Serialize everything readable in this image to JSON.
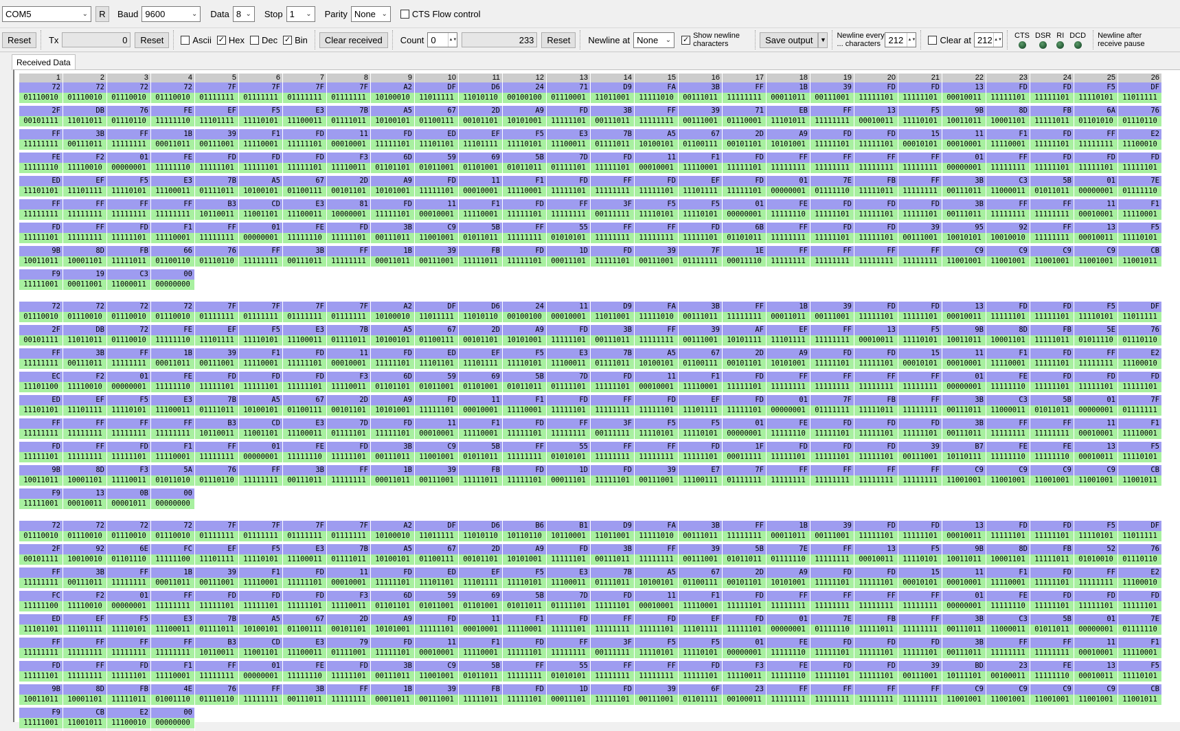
{
  "toolbar1": {
    "port": "COM5",
    "rescan": "R",
    "baud_label": "Baud",
    "baud": "9600",
    "data_label": "Data",
    "data_bits": "8",
    "stop_label": "Stop",
    "stop_bits": "1",
    "parity_label": "Parity",
    "parity": "None",
    "cts_label": "CTS Flow control"
  },
  "toolbar2": {
    "reset": "Reset",
    "tx_label": "Tx",
    "tx_count": "0",
    "tx_reset": "Reset",
    "ascii": "Ascii",
    "hex": "Hex",
    "dec": "Dec",
    "bin": "Bin",
    "clear_received": "Clear received",
    "count_label": "Count",
    "count": "0",
    "received_count": "233",
    "count_reset": "Reset",
    "newline_at_label": "Newline at",
    "newline_at": "None",
    "show_newline": "Show newline characters",
    "save_output": "Save output",
    "newline_every": "Newline every ... characters",
    "newline_every_value": "212",
    "clear_at": "Clear at",
    "clear_at_value": "212",
    "cts": "CTS",
    "dsr": "DSR",
    "ri": "RI",
    "dcd": "DCD",
    "newline_after": "Newline after receive pause"
  },
  "checks": {
    "cts": false,
    "ascii": false,
    "hex": true,
    "dec": false,
    "bin": true,
    "show_newline": true,
    "clear_at": false
  },
  "tab_label": "Received Data",
  "columns": [
    "1",
    "2",
    "3",
    "4",
    "5",
    "6",
    "7",
    "8",
    "9",
    "10",
    "11",
    "12",
    "13",
    "14",
    "15",
    "16",
    "17",
    "18",
    "19",
    "20",
    "21",
    "22",
    "23",
    "24",
    "25",
    "26"
  ],
  "blocks": [
    [
      [
        "72",
        "72",
        "72",
        "72",
        "7F",
        "7F",
        "7F",
        "7F",
        "A2",
        "DF",
        "D6",
        "24",
        "71",
        "D9",
        "FA",
        "3B",
        "FF",
        "1B",
        "39",
        "FD",
        "FD",
        "13",
        "FD",
        "FD",
        "F5",
        "DF"
      ],
      [
        "2F",
        "DB",
        "76",
        "FE",
        "EF",
        "F5",
        "E3",
        "7B",
        "A5",
        "67",
        "2D",
        "A9",
        "FD",
        "3B",
        "FF",
        "39",
        "71",
        "EB",
        "FF",
        "13",
        "F5",
        "9B",
        "8D",
        "FB",
        "6A",
        "76"
      ],
      [
        "FF",
        "3B",
        "FF",
        "1B",
        "39",
        "F1",
        "FD",
        "11",
        "FD",
        "ED",
        "EF",
        "F5",
        "E3",
        "7B",
        "A5",
        "67",
        "2D",
        "A9",
        "FD",
        "FD",
        "15",
        "11",
        "F1",
        "FD",
        "FF",
        "E2"
      ],
      [
        "FE",
        "F2",
        "01",
        "FE",
        "FD",
        "FD",
        "FD",
        "F3",
        "6D",
        "59",
        "69",
        "5B",
        "7D",
        "FD",
        "11",
        "F1",
        "FD",
        "FF",
        "FF",
        "FF",
        "FF",
        "01",
        "FF",
        "FD",
        "FD",
        "FD"
      ],
      [
        "ED",
        "EF",
        "F5",
        "E3",
        "7B",
        "A5",
        "67",
        "2D",
        "A9",
        "FD",
        "11",
        "F1",
        "FD",
        "FF",
        "FD",
        "EF",
        "FD",
        "01",
        "7E",
        "FB",
        "FF",
        "3B",
        "C3",
        "5B",
        "01",
        "7E"
      ],
      [
        "FF",
        "FF",
        "FF",
        "FF",
        "B3",
        "CD",
        "E3",
        "81",
        "FD",
        "11",
        "F1",
        "FD",
        "FF",
        "3F",
        "F5",
        "F5",
        "01",
        "FE",
        "FD",
        "FD",
        "FD",
        "3B",
        "FF",
        "FF",
        "11",
        "F1"
      ],
      [
        "FD",
        "FF",
        "FD",
        "F1",
        "FF",
        "01",
        "FE",
        "FD",
        "3B",
        "C9",
        "5B",
        "FF",
        "55",
        "FF",
        "FF",
        "FD",
        "6B",
        "FF",
        "FD",
        "FD",
        "39",
        "95",
        "92",
        "FF",
        "13",
        "F5"
      ],
      [
        "9B",
        "8D",
        "FB",
        "66",
        "76",
        "FF",
        "3B",
        "FF",
        "1B",
        "39",
        "FB",
        "FD",
        "1D",
        "FD",
        "39",
        "7F",
        "1E",
        "FF",
        "FF",
        "FF",
        "FF",
        "C9",
        "C9",
        "C9",
        "C9",
        "CB"
      ],
      [
        "F9",
        "19",
        "C3",
        "00"
      ]
    ],
    [
      [
        "72",
        "72",
        "72",
        "72",
        "7F",
        "7F",
        "7F",
        "7F",
        "A2",
        "DF",
        "D6",
        "24",
        "11",
        "D9",
        "FA",
        "3B",
        "FF",
        "1B",
        "39",
        "FD",
        "FD",
        "13",
        "FD",
        "FD",
        "F5",
        "DF"
      ],
      [
        "2F",
        "DB",
        "72",
        "FE",
        "EF",
        "F5",
        "E3",
        "7B",
        "A5",
        "67",
        "2D",
        "A9",
        "FD",
        "3B",
        "FF",
        "39",
        "AF",
        "EF",
        "FF",
        "13",
        "F5",
        "9B",
        "8D",
        "FB",
        "5E",
        "76"
      ],
      [
        "FF",
        "3B",
        "FF",
        "1B",
        "39",
        "F1",
        "FD",
        "11",
        "FD",
        "ED",
        "EF",
        "F5",
        "E3",
        "7B",
        "A5",
        "67",
        "2D",
        "A9",
        "FD",
        "FD",
        "15",
        "11",
        "F1",
        "FD",
        "FF",
        "E2"
      ],
      [
        "EC",
        "F2",
        "01",
        "FE",
        "FD",
        "FD",
        "FD",
        "F3",
        "6D",
        "59",
        "69",
        "5B",
        "7D",
        "FD",
        "11",
        "F1",
        "FD",
        "FF",
        "FF",
        "FF",
        "FF",
        "01",
        "FE",
        "FD",
        "FD",
        "FD"
      ],
      [
        "ED",
        "EF",
        "F5",
        "E3",
        "7B",
        "A5",
        "67",
        "2D",
        "A9",
        "FD",
        "11",
        "F1",
        "FD",
        "FF",
        "FD",
        "EF",
        "FD",
        "01",
        "7F",
        "FB",
        "FF",
        "3B",
        "C3",
        "5B",
        "01",
        "7F"
      ],
      [
        "FF",
        "FF",
        "FF",
        "FF",
        "B3",
        "CD",
        "E3",
        "7D",
        "FD",
        "11",
        "F1",
        "FD",
        "FF",
        "3F",
        "F5",
        "F5",
        "01",
        "FE",
        "FD",
        "FD",
        "FD",
        "3B",
        "FF",
        "FF",
        "11",
        "F1"
      ],
      [
        "FD",
        "FF",
        "FD",
        "F1",
        "FF",
        "01",
        "FE",
        "FD",
        "3B",
        "C9",
        "5B",
        "FF",
        "55",
        "FF",
        "FF",
        "FD",
        "1F",
        "FD",
        "FD",
        "FD",
        "39",
        "B7",
        "FE",
        "FE",
        "13",
        "F5"
      ],
      [
        "9B",
        "8D",
        "F3",
        "5A",
        "76",
        "FF",
        "3B",
        "FF",
        "1B",
        "39",
        "FB",
        "FD",
        "1D",
        "FD",
        "39",
        "E7",
        "7F",
        "FF",
        "FF",
        "FF",
        "FF",
        "C9",
        "C9",
        "C9",
        "C9",
        "CB"
      ],
      [
        "F9",
        "13",
        "0B",
        "00"
      ]
    ],
    [
      [
        "72",
        "72",
        "72",
        "72",
        "7F",
        "7F",
        "7F",
        "7F",
        "A2",
        "DF",
        "D6",
        "B6",
        "B1",
        "D9",
        "FA",
        "3B",
        "FF",
        "1B",
        "39",
        "FD",
        "FD",
        "13",
        "FD",
        "FD",
        "F5",
        "DF"
      ],
      [
        "2F",
        "92",
        "6E",
        "FC",
        "EF",
        "F5",
        "E3",
        "7B",
        "A5",
        "67",
        "2D",
        "A9",
        "FD",
        "3B",
        "FF",
        "39",
        "5B",
        "7E",
        "FF",
        "13",
        "F5",
        "9B",
        "8D",
        "FB",
        "52",
        "76"
      ],
      [
        "FF",
        "3B",
        "FF",
        "1B",
        "39",
        "F1",
        "FD",
        "11",
        "FD",
        "ED",
        "EF",
        "F5",
        "E3",
        "7B",
        "A5",
        "67",
        "2D",
        "A9",
        "FD",
        "FD",
        "15",
        "11",
        "F1",
        "FD",
        "FF",
        "E2"
      ],
      [
        "FC",
        "F2",
        "01",
        "FF",
        "FD",
        "FD",
        "FD",
        "F3",
        "6D",
        "59",
        "69",
        "5B",
        "7D",
        "FD",
        "11",
        "F1",
        "FD",
        "FF",
        "FF",
        "FF",
        "FF",
        "01",
        "FE",
        "FD",
        "FD",
        "FD"
      ],
      [
        "ED",
        "EF",
        "F5",
        "E3",
        "7B",
        "A5",
        "67",
        "2D",
        "A9",
        "FD",
        "11",
        "F1",
        "FD",
        "FF",
        "FD",
        "EF",
        "FD",
        "01",
        "7E",
        "FB",
        "FF",
        "3B",
        "C3",
        "5B",
        "01",
        "7E"
      ],
      [
        "FF",
        "FF",
        "FF",
        "FF",
        "B3",
        "CD",
        "E3",
        "79",
        "FD",
        "11",
        "F1",
        "FD",
        "FF",
        "3F",
        "F5",
        "F5",
        "01",
        "FE",
        "FD",
        "FD",
        "FD",
        "3B",
        "FF",
        "FF",
        "11",
        "F1"
      ],
      [
        "FD",
        "FF",
        "FD",
        "F1",
        "FF",
        "01",
        "FE",
        "FD",
        "3B",
        "C9",
        "5B",
        "FF",
        "55",
        "FF",
        "FF",
        "FD",
        "F3",
        "FE",
        "FD",
        "FD",
        "39",
        "BD",
        "23",
        "FE",
        "13",
        "F5"
      ],
      [
        "9B",
        "8D",
        "FB",
        "4E",
        "76",
        "FF",
        "3B",
        "FF",
        "1B",
        "39",
        "FB",
        "FD",
        "1D",
        "FD",
        "39",
        "6F",
        "23",
        "FF",
        "FF",
        "FF",
        "FF",
        "C9",
        "C9",
        "C9",
        "C9",
        "CB"
      ],
      [
        "F9",
        "CB",
        "E2",
        "00"
      ]
    ]
  ]
}
